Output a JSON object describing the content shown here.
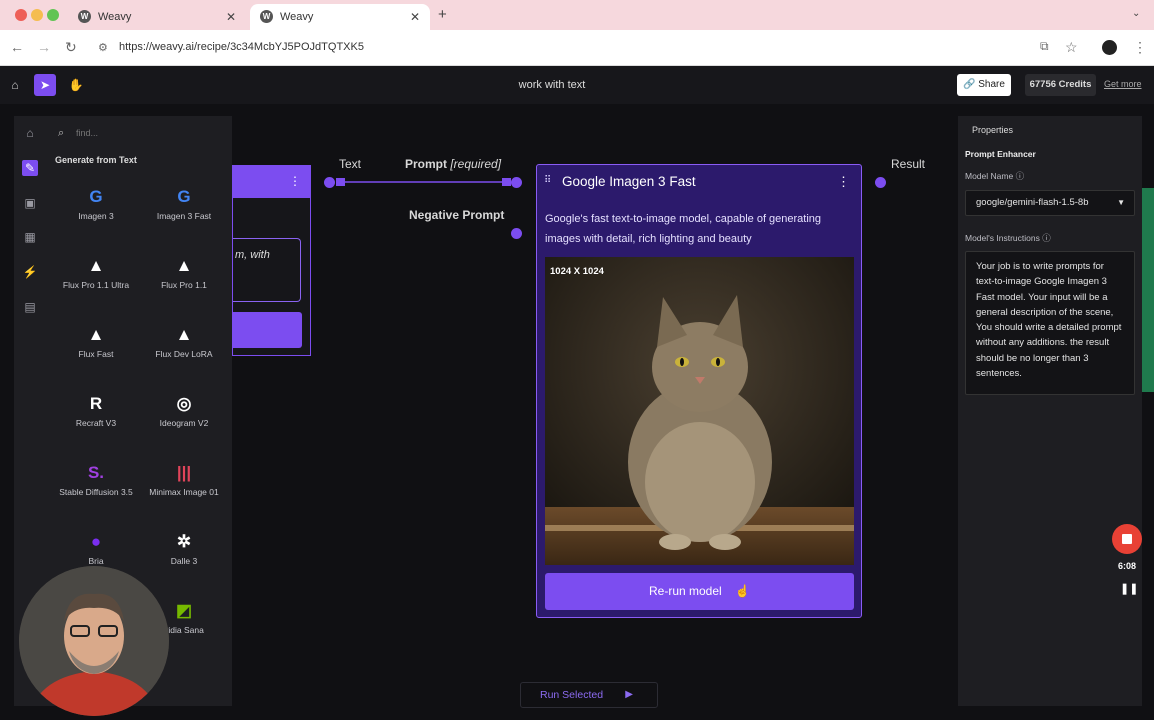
{
  "browser": {
    "tabs": [
      {
        "title": "Weavy"
      },
      {
        "title": "Weavy"
      }
    ],
    "url": "https://weavy.ai/recipe/3c34McbYJ5POJdTQTXK5"
  },
  "header": {
    "title": "work with text",
    "share_label": "Share",
    "credits": "67756 Credits",
    "get_more": "Get more"
  },
  "panel": {
    "search_placeholder": "find...",
    "section_title": "Generate from Text",
    "models": [
      {
        "label": "Imagen 3",
        "logo": "G"
      },
      {
        "label": "Imagen 3 Fast",
        "logo": "G"
      },
      {
        "label": "Flux Pro 1.1 Ultra",
        "logo": "▲"
      },
      {
        "label": "Flux Pro 1.1",
        "logo": "▲"
      },
      {
        "label": "Flux Fast",
        "logo": "▲"
      },
      {
        "label": "Flux Dev LoRA",
        "logo": "▲"
      },
      {
        "label": "Recraft V3",
        "logo": "R"
      },
      {
        "label": "Ideogram V2",
        "logo": "◎"
      },
      {
        "label": "Stable Diffusion 3.5",
        "logo": "S."
      },
      {
        "label": "Minimax Image 01",
        "logo": "|||"
      },
      {
        "label": "Bria",
        "logo": "●"
      },
      {
        "label": "Dalle 3",
        "logo": "✲"
      },
      {
        "label": "vidia Sana",
        "logo": "◩"
      }
    ]
  },
  "left_node": {
    "partial_text": "m, with"
  },
  "canvas_labels": {
    "text": "Text",
    "prompt": "Prompt",
    "prompt_required": "[required]",
    "negative_prompt": "Negative Prompt",
    "result": "Result"
  },
  "main_node": {
    "title": "Google Imagen 3 Fast",
    "description": "Google's fast text-to-image model, capable of generating images with detail, rich lighting and beauty",
    "resolution": "1024 X 1024",
    "rerun_label": "Re-run model"
  },
  "properties": {
    "heading": "Properties",
    "section": "Prompt Enhancer",
    "model_name_label": "Model Name",
    "model_name_value": "google/gemini-flash-1.5-8b",
    "instructions_label": "Model's Instructions",
    "instructions_value": "Your job is to write prompts for text-to-image Google Imagen 3 Fast model. Your input will be a general description of the scene, You should write a detailed prompt without any additions. the result should be no longer than 3 sentences."
  },
  "recorder": {
    "time": "6:08"
  },
  "run_selected": "Run Selected",
  "colors": {
    "accent": "#7c4df0",
    "record": "#e84135"
  }
}
